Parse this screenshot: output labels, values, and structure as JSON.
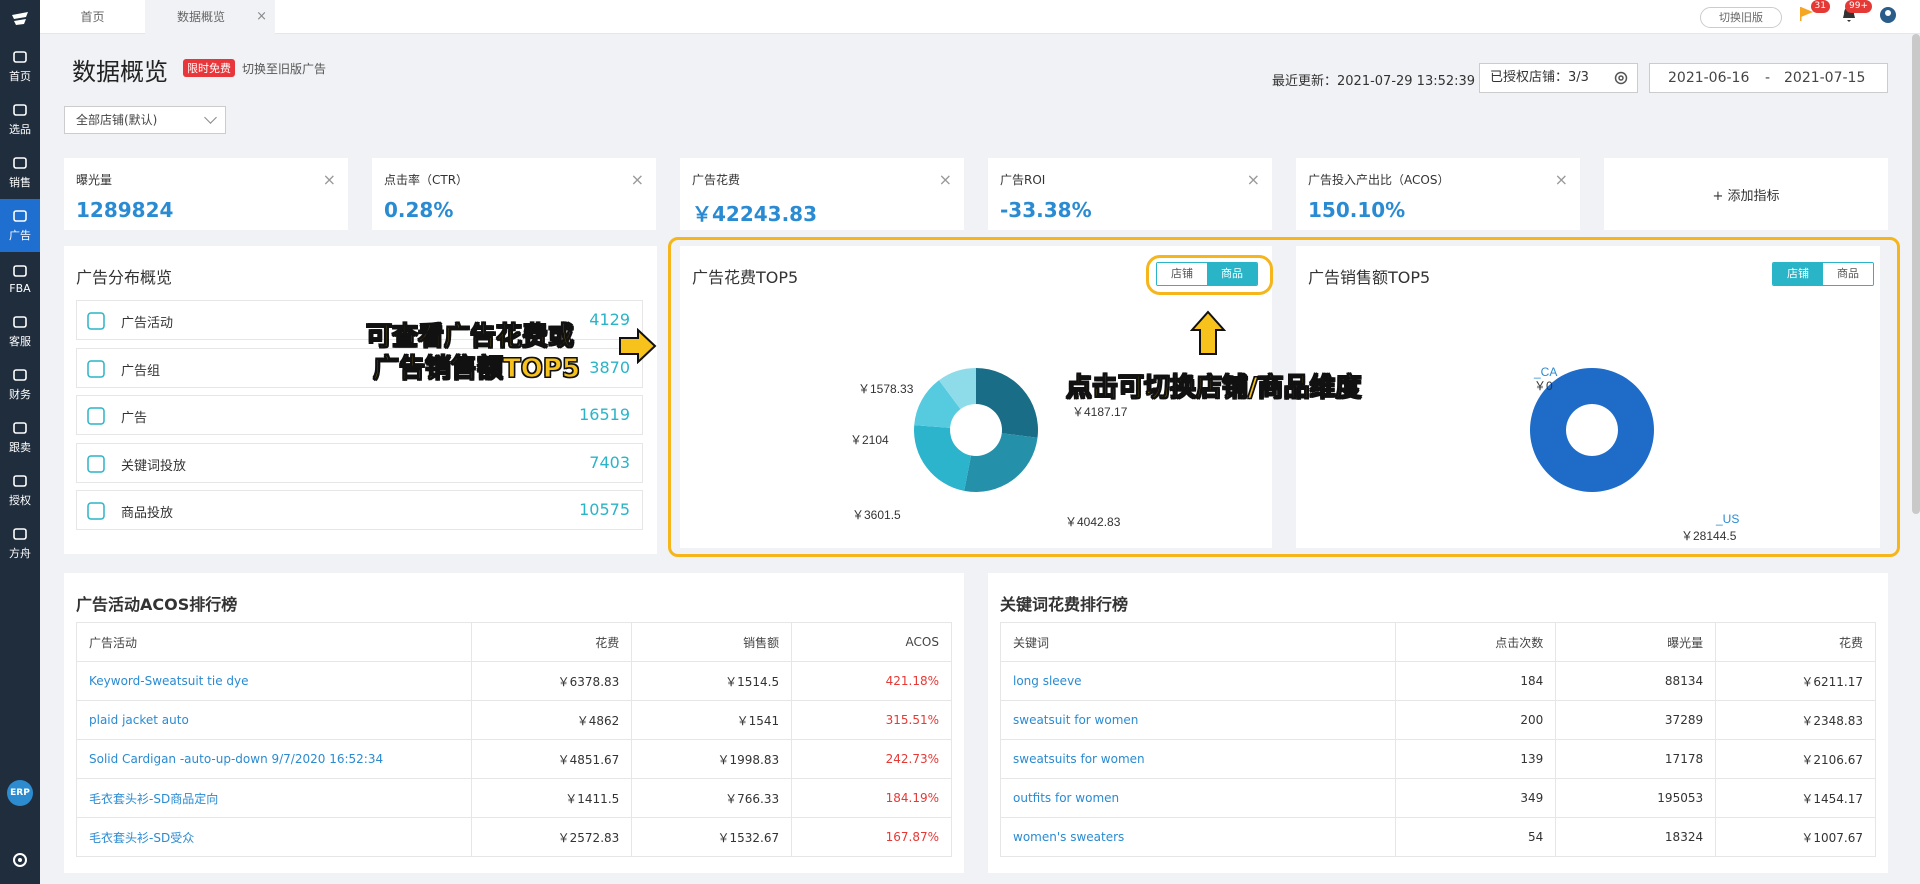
{
  "sidebar": {
    "items": [
      {
        "label": "首页",
        "icon": "home-icon"
      },
      {
        "label": "选品",
        "icon": "search-icon"
      },
      {
        "label": "销售",
        "icon": "chart-line-icon"
      },
      {
        "label": "广告",
        "icon": "ad-icon",
        "active": true
      },
      {
        "label": "FBA",
        "icon": "fba-icon"
      },
      {
        "label": "客服",
        "icon": "service-icon"
      },
      {
        "label": "财务",
        "icon": "finance-icon"
      },
      {
        "label": "跟卖",
        "icon": "pie-icon"
      },
      {
        "label": "授权",
        "icon": "shield-icon"
      },
      {
        "label": "方舟",
        "icon": "ark-icon"
      }
    ],
    "erp_label": "ERP"
  },
  "topbar": {
    "tabs": [
      {
        "label": "首页"
      },
      {
        "label": "数据概览",
        "close": "×"
      }
    ],
    "old_version": "切换旧版",
    "flag_badge": "31",
    "bell_badge": "99+"
  },
  "header": {
    "title": "数据概览",
    "free_tag": "限时免费",
    "switch_old_ad": "切换至旧版广告",
    "last_update": "最近更新：2021-07-29 13:52:39",
    "authorized_stores": "已授权店铺：3/3",
    "date_start": "2021-06-16",
    "date_sep": "-",
    "date_end": "2021-07-15",
    "store_select": "全部店铺(默认)"
  },
  "metrics": [
    {
      "label": "曝光量",
      "value": "1289824"
    },
    {
      "label": "点击率（CTR）",
      "value": "0.28%"
    },
    {
      "label": "广告花费",
      "value": "￥42243.83"
    },
    {
      "label": "广告ROI",
      "value": "-33.38%"
    },
    {
      "label": "广告投入产出比（ACOS）",
      "value": "150.10%"
    }
  ],
  "add_metric": "+ 添加指标",
  "distribution": {
    "title": "广告分布概览",
    "rows": [
      {
        "label": "广告活动",
        "value": "4129",
        "icon": "grid-icon"
      },
      {
        "label": "广告组",
        "value": "3870",
        "icon": "copy-icon"
      },
      {
        "label": "广告",
        "value": "16519",
        "icon": "ad-badge-icon"
      },
      {
        "label": "关键词投放",
        "value": "7403",
        "icon": "k-circle-icon"
      },
      {
        "label": "商品投放",
        "value": "10575",
        "icon": "p-circle-icon"
      }
    ]
  },
  "spend_top5": {
    "title": "广告花费TOP5",
    "toggle": [
      "店铺",
      "商品"
    ],
    "labels": [
      "￥1578.33",
      "￥2104",
      "￥3601.5",
      "￥4042.83",
      "￥4187.17"
    ]
  },
  "sales_top5": {
    "title": "广告销售额TOP5",
    "toggle": [
      "店铺",
      "商品"
    ],
    "labels": [
      "_CA",
      "￥0",
      "_US",
      "￥28144.5"
    ]
  },
  "chart_data": [
    {
      "type": "pie",
      "title": "广告花费TOP5",
      "values": [
        4187.17,
        4042.83,
        3601.5,
        2104,
        1578.33
      ],
      "colors": [
        "#1a6d86",
        "#2590a9",
        "#2bb4cc",
        "#56cbe0",
        "#8edcea"
      ]
    },
    {
      "type": "pie",
      "title": "广告销售额TOP5",
      "categories": [
        "_US",
        "_CA"
      ],
      "values": [
        28144.5,
        0
      ],
      "colors": [
        "#1e6bc8",
        "#1e6bc8"
      ]
    }
  ],
  "annotations": {
    "left_line1": "可查看广告花费或",
    "left_line2": "广告销售额TOP5",
    "right": "点击可切换店铺/商品维度"
  },
  "acos_rank": {
    "title": "广告活动ACOS排行榜",
    "headers": [
      "广告活动",
      "花费",
      "销售额",
      "ACOS"
    ],
    "rows": [
      [
        "Keyword-Sweatsuit tie dye",
        "￥6378.83",
        "￥1514.5",
        "421.18%"
      ],
      [
        "plaid jacket auto",
        "￥4862",
        "￥1541",
        "315.51%"
      ],
      [
        "Solid Cardigan -auto-up-down 9/7/2020 16:52:34",
        "￥4851.67",
        "￥1998.83",
        "242.73%"
      ],
      [
        "毛衣套头衫-SD商品定向",
        "￥1411.5",
        "￥766.33",
        "184.19%"
      ],
      [
        "毛衣套头衫-SD受众",
        "￥2572.83",
        "￥1532.67",
        "167.87%"
      ]
    ]
  },
  "keyword_rank": {
    "title": "关键词花费排行榜",
    "headers": [
      "关键词",
      "点击次数",
      "曝光量",
      "花费"
    ],
    "rows": [
      [
        "long sleeve",
        "184",
        "88134",
        "￥6211.17"
      ],
      [
        "sweatsuit for women",
        "200",
        "37289",
        "￥2348.83"
      ],
      [
        "sweatsuits for women",
        "139",
        "17178",
        "￥2106.67"
      ],
      [
        "outfits for women",
        "349",
        "195053",
        "￥1454.17"
      ],
      [
        "women's sweaters",
        "54",
        "18324",
        "￥1007.67"
      ]
    ]
  }
}
